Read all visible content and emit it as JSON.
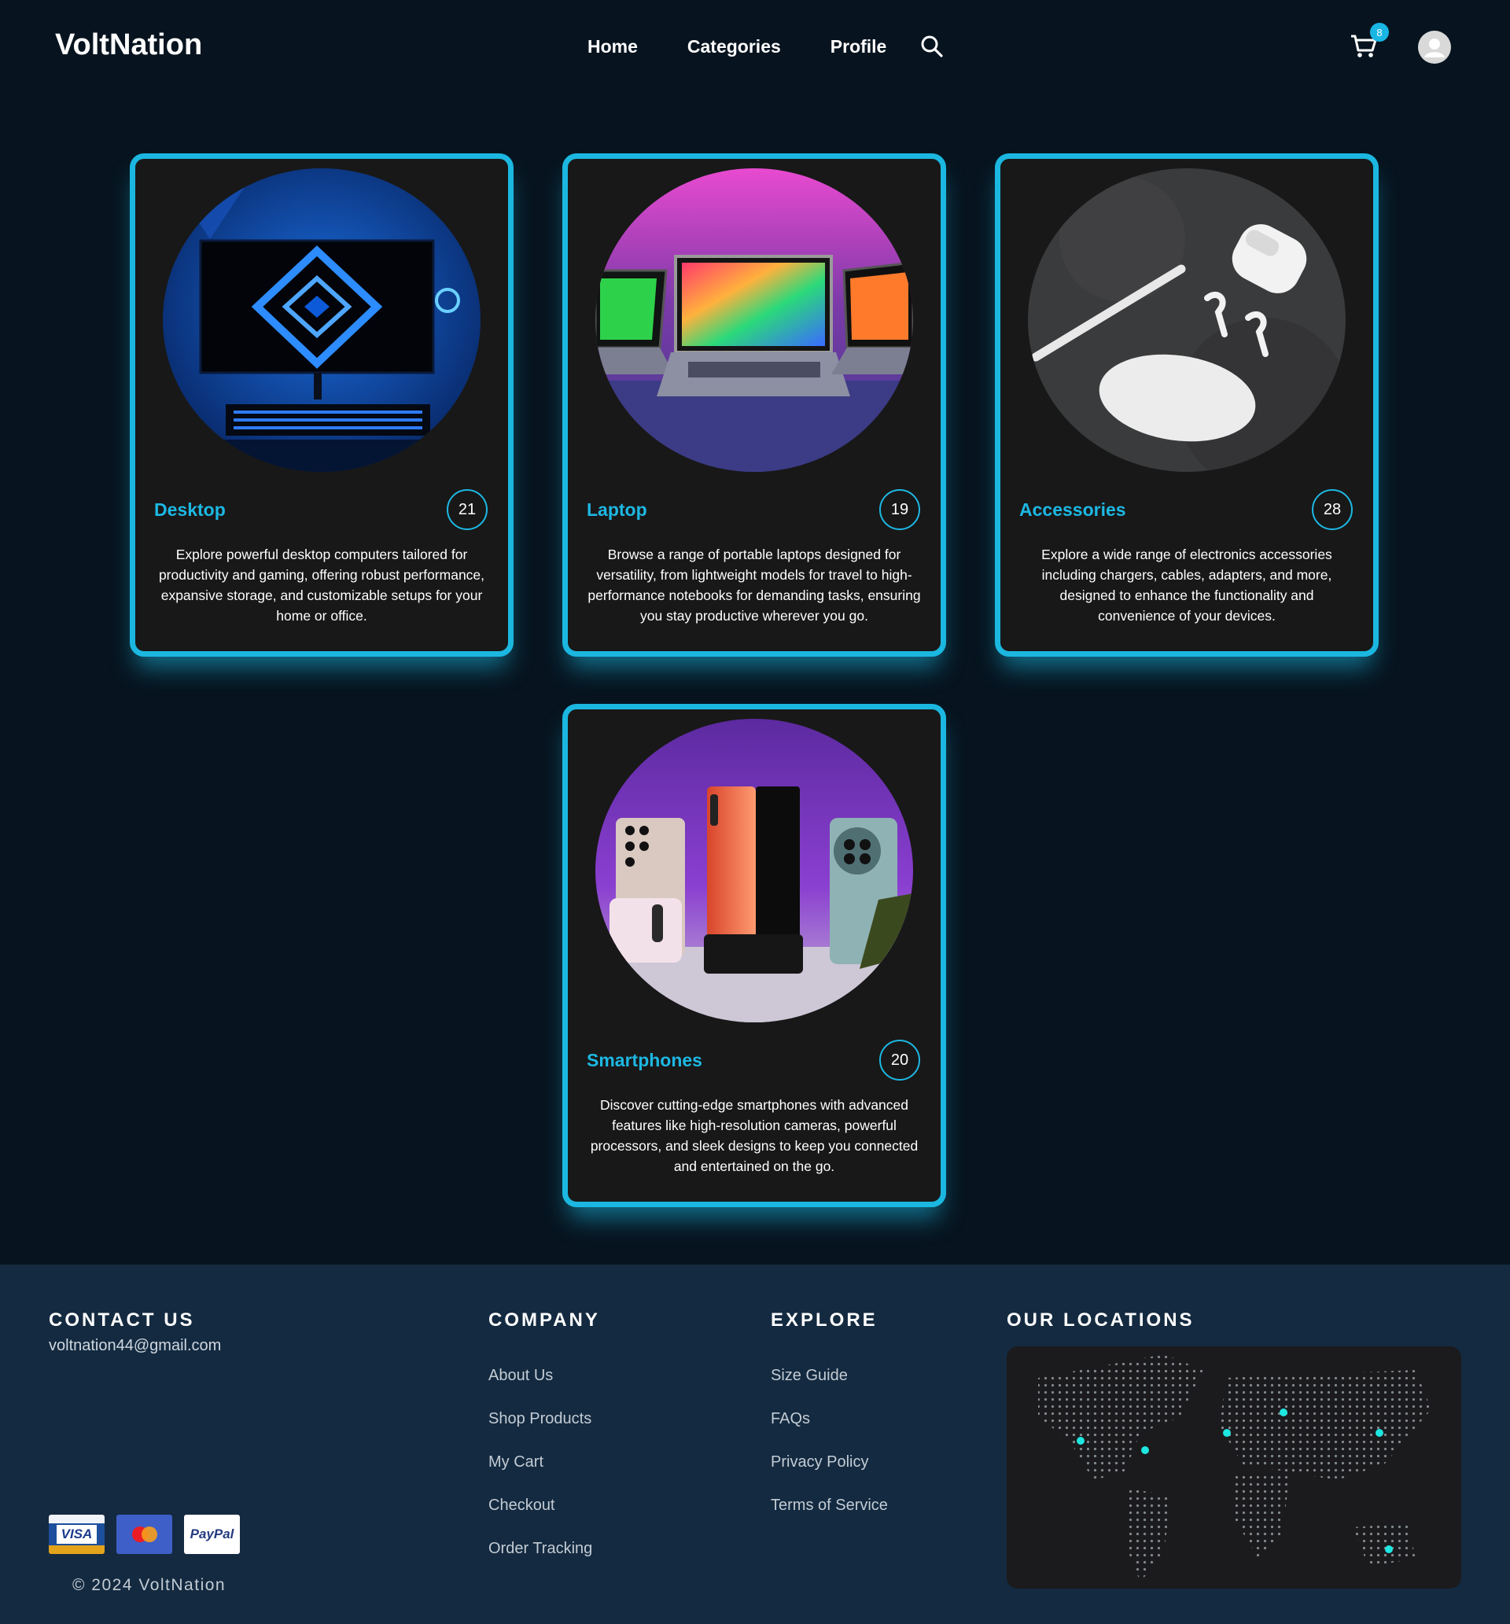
{
  "header": {
    "logo": "VoltNation",
    "nav": [
      "Home",
      "Categories",
      "Profile"
    ],
    "cart_count": "8",
    "icons": {
      "search": "search-icon",
      "cart": "cart-icon",
      "profile": "user-avatar-icon"
    }
  },
  "categories": [
    {
      "title": "Desktop",
      "count": "21",
      "description": "Explore powerful desktop computers tailored for productivity and gaming, offering robust performance, expansive storage, and customizable setups for your home or office."
    },
    {
      "title": "Laptop",
      "count": "19",
      "description": "Browse a range of portable laptops designed for versatility, from lightweight models for travel to high-performance notebooks for demanding tasks, ensuring you stay productive wherever you go."
    },
    {
      "title": "Accessories",
      "count": "28",
      "description": "Explore a wide range of electronics accessories including chargers, cables, adapters, and more, designed to enhance the functionality and convenience of your devices."
    },
    {
      "title": "Smartphones",
      "count": "20",
      "description": "Discover cutting-edge smartphones with advanced features like high-resolution cameras, powerful processors, and sleek designs to keep you connected and entertained on the go."
    }
  ],
  "footer": {
    "contact_heading": "CONTACT US",
    "email": "voltnation44@gmail.com",
    "company_heading": "COMPANY",
    "company_links": [
      "About Us",
      "Shop Products",
      "My Cart",
      "Checkout",
      "Order Tracking"
    ],
    "explore_heading": "EXPLORE",
    "explore_links": [
      "Size Guide",
      "FAQs",
      "Privacy Policy",
      "Terms of Service"
    ],
    "locations_heading": "OUR LOCATIONS",
    "payments": [
      "VISA",
      "Mastercard",
      "PayPal"
    ],
    "copyright": "© 2024 VoltNation"
  },
  "colors": {
    "background": "#07141f",
    "accent": "#1bb7e0",
    "card_bg": "#181818",
    "footer_bg": "#142a40"
  }
}
